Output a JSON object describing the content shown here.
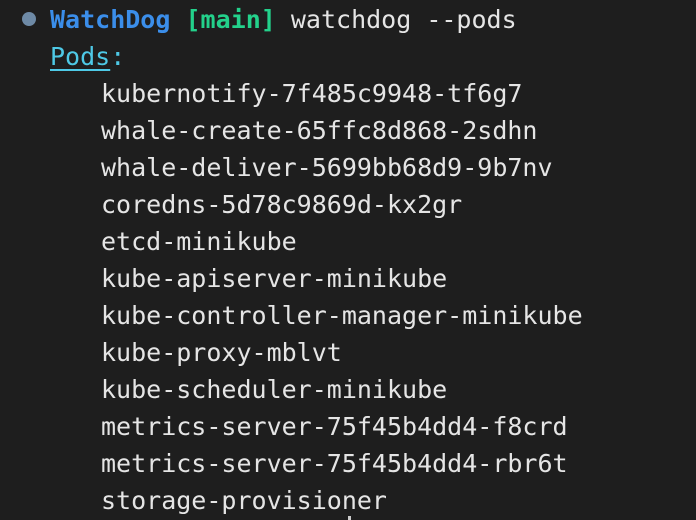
{
  "window": {
    "background": "#1e1e1e"
  },
  "prompt": {
    "app_name": "WatchDog",
    "branch": "[main]",
    "command": "watchdog --pods",
    "dot_color": "#6e8aa6",
    "app_color": "#3b8eea",
    "branch_color": "#23d18b"
  },
  "section": {
    "label": "Pods",
    "colon": ":",
    "color": "#4ec9e6"
  },
  "pods": [
    "kubernotify-7f485c9948-tf6g7",
    "whale-create-65ffc8d868-2sdhn",
    "whale-deliver-5699bb68d9-9b7nv",
    "coredns-5d78c9869d-kx2gr",
    "etcd-minikube",
    "kube-apiserver-minikube",
    "kube-controller-manager-minikube",
    "kube-proxy-mblvt",
    "kube-scheduler-minikube",
    "metrics-server-75f45b4dd4-f8crd",
    "metrics-server-75f45b4dd4-rbr6t",
    "storage-provisioner"
  ]
}
